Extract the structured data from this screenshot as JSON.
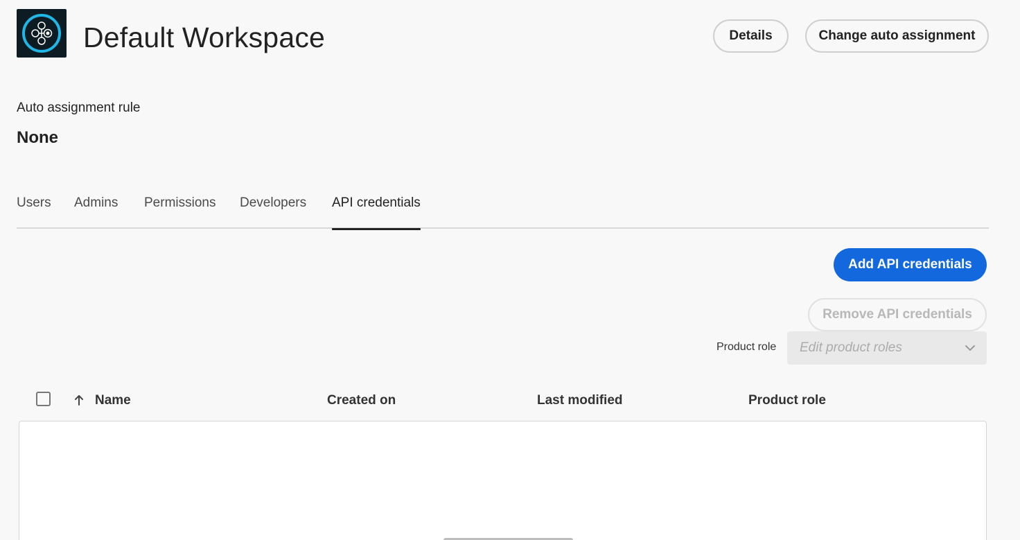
{
  "header": {
    "title": "Default Workspace",
    "details_label": "Details",
    "change_label": "Change auto assignment"
  },
  "rule": {
    "label": "Auto assignment rule",
    "value": "None"
  },
  "tabs": [
    {
      "label": "Users",
      "active": false
    },
    {
      "label": "Admins",
      "active": false
    },
    {
      "label": "Permissions",
      "active": false
    },
    {
      "label": "Developers",
      "active": false
    },
    {
      "label": "API credentials",
      "active": true
    }
  ],
  "actions": {
    "add_label": "Add API credentials",
    "remove_label": "Remove API credentials",
    "role_label": "Product role",
    "role_placeholder": "Edit product roles"
  },
  "table": {
    "columns": [
      "Name",
      "Created on",
      "Last modified",
      "Product role"
    ],
    "sort_icon": "arrow-up-icon",
    "rows": []
  },
  "colors": {
    "accent": "#1268dc",
    "background": "#f8f8f8",
    "logo_bg": "#0d1b22",
    "logo_ring": "#1fb6e8"
  }
}
